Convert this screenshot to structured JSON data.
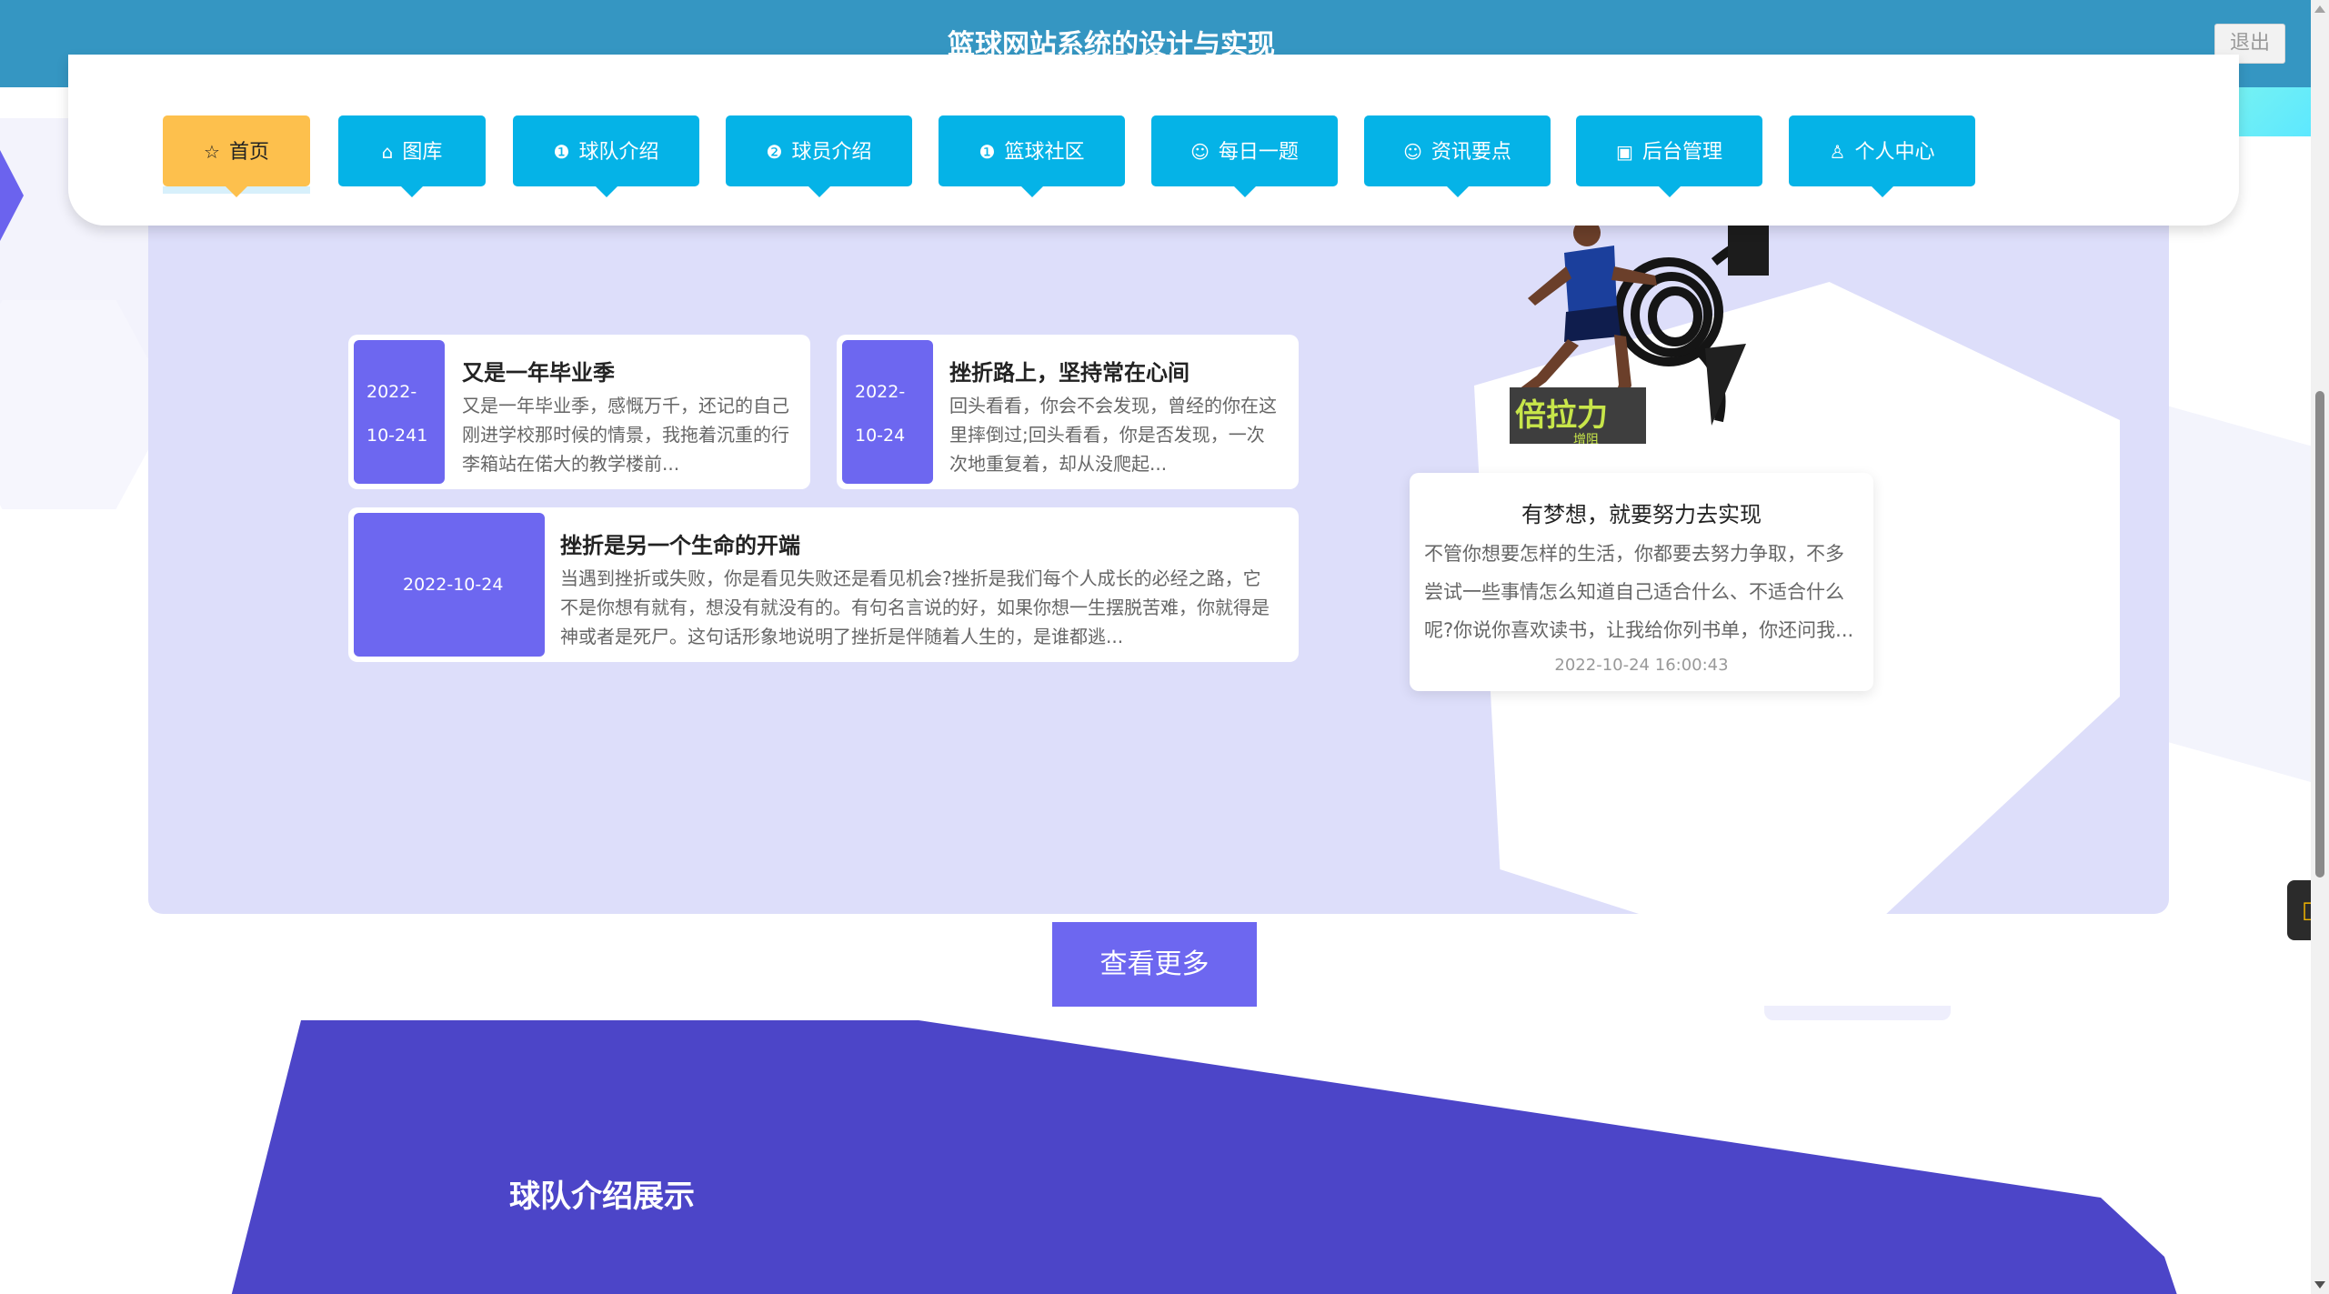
{
  "header": {
    "title": "篮球网站系统的设计与实现",
    "logout_label": "退出",
    "bg_color": "#3596c2"
  },
  "nav": {
    "items": [
      {
        "label": "首页",
        "icon": "star-icon",
        "glyph": "☆",
        "active": true
      },
      {
        "label": "图库",
        "icon": "bag-icon",
        "glyph": "⌂",
        "active": false
      },
      {
        "label": "球队介绍",
        "icon": "info-circle-icon",
        "glyph": "❶",
        "active": false
      },
      {
        "label": "球员介绍",
        "icon": "question-circle-icon",
        "glyph": "❷",
        "active": false
      },
      {
        "label": "篮球社区",
        "icon": "info-circle-icon",
        "glyph": "❶",
        "active": false
      },
      {
        "label": "每日一题",
        "icon": "smile-icon",
        "glyph": "☺",
        "active": false
      },
      {
        "label": "资讯要点",
        "icon": "smile-circle-icon",
        "glyph": "☺",
        "active": false
      },
      {
        "label": "后台管理",
        "icon": "briefcase-icon",
        "glyph": "▣",
        "active": false
      },
      {
        "label": "个人中心",
        "icon": "user-icon",
        "glyph": "♙",
        "active": false
      }
    ],
    "item_color": "#05b3e7",
    "active_color": "#fdc04d"
  },
  "news": {
    "items": [
      {
        "date_line1": "2022-",
        "date_line2": "10-241",
        "title": "又是一年毕业季",
        "excerpt": "又是一年毕业季，感慨万千，还记的自己刚进学校那时候的情景，我拖着沉重的行李箱站在偌大的教学楼前..."
      },
      {
        "date_line1": "2022-",
        "date_line2": "10-24",
        "title": "挫折路上，坚持常在心间",
        "excerpt": "回头看看，你会不会发现，曾经的你在这里摔倒过;回头看看，你是否发现，一次次地重复着，却从没爬起..."
      },
      {
        "date": "2022-10-24",
        "title": "挫折是另一个生命的开端",
        "excerpt": "当遇到挫折或失败，你是看见失败还是看见机会?挫折是我们每个人成长的必经之路，它不是你想有就有，想没有就没有的。有句名言说的好，如果你想一生摆脱苦难，你就得是神或者是死尸。这句话形象地说明了挫折是伴随着人生的，是谁都逃..."
      }
    ],
    "featured": {
      "image_caption": "倍拉力",
      "image_subcaption": "增阻",
      "title": "有梦想，就要努力去实现",
      "excerpt": "不管你想要怎样的生活，你都要去努力争取，不多尝试一些事情怎么知道自己适合什么、不适合什么呢?你说你喜欢读书，让我给你列书单，你还问我...",
      "time": "2022-10-24 16:00:43"
    },
    "more_label": "查看更多",
    "accent_color": "#6d67f0"
  },
  "team_section": {
    "title": "球队介绍展示",
    "bg_color": "#4c45c8"
  }
}
